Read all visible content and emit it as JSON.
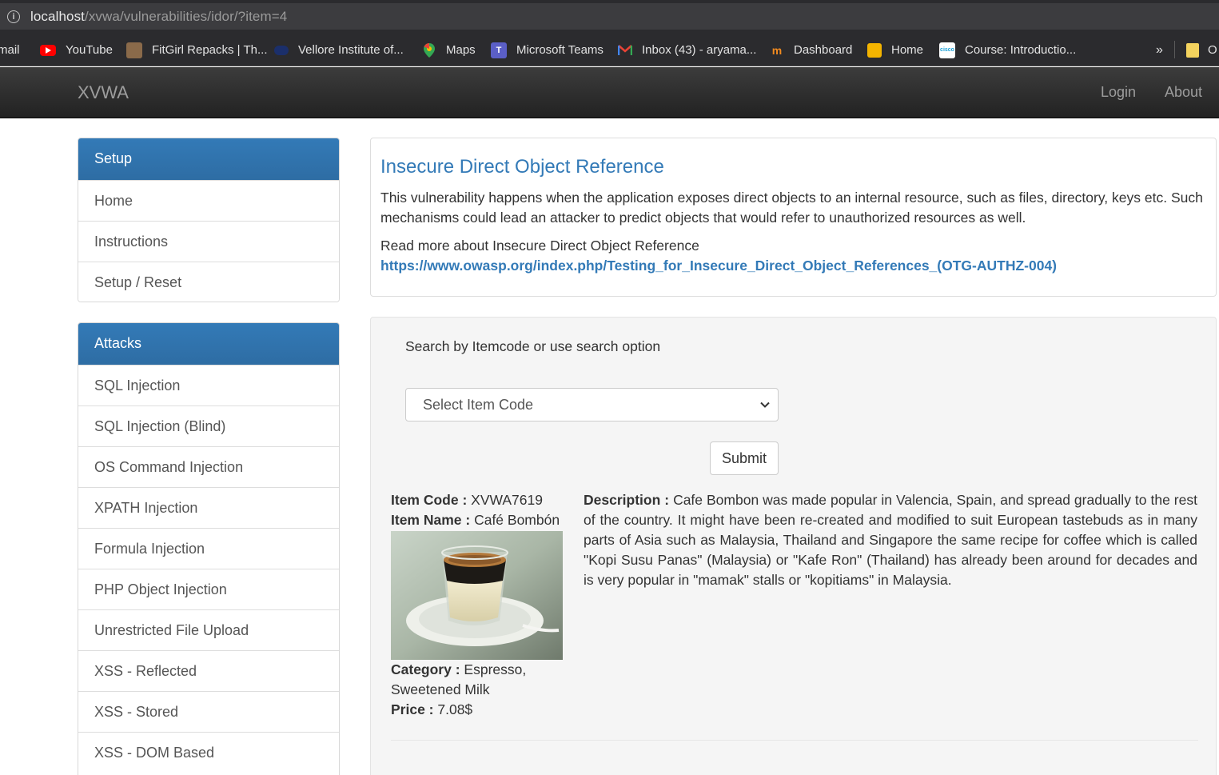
{
  "browser": {
    "url_host": "localhost",
    "url_path": "/xvwa/vulnerabilities/idor/?item=4",
    "bookmarks": [
      {
        "label": "mail",
        "icon": "gmail-icon"
      },
      {
        "label": "YouTube",
        "icon": "youtube-icon"
      },
      {
        "label": "FitGirl Repacks | Th...",
        "icon": "fitgirl-icon"
      },
      {
        "label": "Vellore Institute of...",
        "icon": "vit-icon"
      },
      {
        "label": "Maps",
        "icon": "maps-icon"
      },
      {
        "label": "Microsoft Teams",
        "icon": "teams-icon"
      },
      {
        "label": "Inbox (43) - aryama...",
        "icon": "gmail-icon"
      },
      {
        "label": "Dashboard",
        "icon": "dashboard-icon"
      },
      {
        "label": "Home",
        "icon": "home-box-icon"
      },
      {
        "label": "Course: Introductio...",
        "icon": "cisco-icon"
      }
    ],
    "overflow": "»",
    "other_folder": "O"
  },
  "navbar": {
    "brand": "XVWA",
    "login": "Login",
    "about": "About"
  },
  "sidebar": {
    "setup": {
      "heading": "Setup",
      "items": [
        "Home",
        "Instructions",
        "Setup / Reset"
      ]
    },
    "attacks": {
      "heading": "Attacks",
      "items": [
        "SQL Injection",
        "SQL Injection (Blind)",
        "OS Command Injection",
        "XPATH Injection",
        "Formula Injection",
        "PHP Object Injection",
        "Unrestricted File Upload",
        "XSS - Reflected",
        "XSS - Stored",
        "XSS - DOM Based"
      ]
    }
  },
  "info": {
    "title": "Insecure Direct Object Reference",
    "description": "This vulnerability happens when the application exposes direct objects to an internal resource, such as files, directory, keys etc. Such mechanisms could lead an attacker to predict objects that would refer to unauthorized resources as well.",
    "read_more": "Read more about Insecure Direct Object Reference",
    "link": "https://www.owasp.org/index.php/Testing_for_Insecure_Direct_Object_References_(OTG-AUTHZ-004)"
  },
  "search": {
    "label": "Search by Itemcode or use search option",
    "select_value": "Select Item Code",
    "submit": "Submit"
  },
  "item": {
    "code_label": "Item Code :",
    "code": "XVWA7619",
    "name_label": "Item Name :",
    "name": "Café Bombón",
    "category_label": "Category :",
    "category": "Espresso, Sweetened Milk",
    "price_label": "Price :",
    "price": "7.08$",
    "description_label": "Description :",
    "description": "Cafe Bombon was made popular in Valencia, Spain, and spread gradually to the rest of the country. It might have been re-created and modified to suit European tastebuds as in many parts of Asia such as Malaysia, Thailand and Singapore the same recipe for coffee which is called \"Kopi Susu Panas\" (Malaysia) or \"Kafe Ron\" (Thailand) has already been around for decades and is very popular in \"mamak\" stalls or \"kopitiams\" in Malaysia."
  },
  "colors": {
    "brand_blue": "#337ab7",
    "navbar": "#222222"
  }
}
